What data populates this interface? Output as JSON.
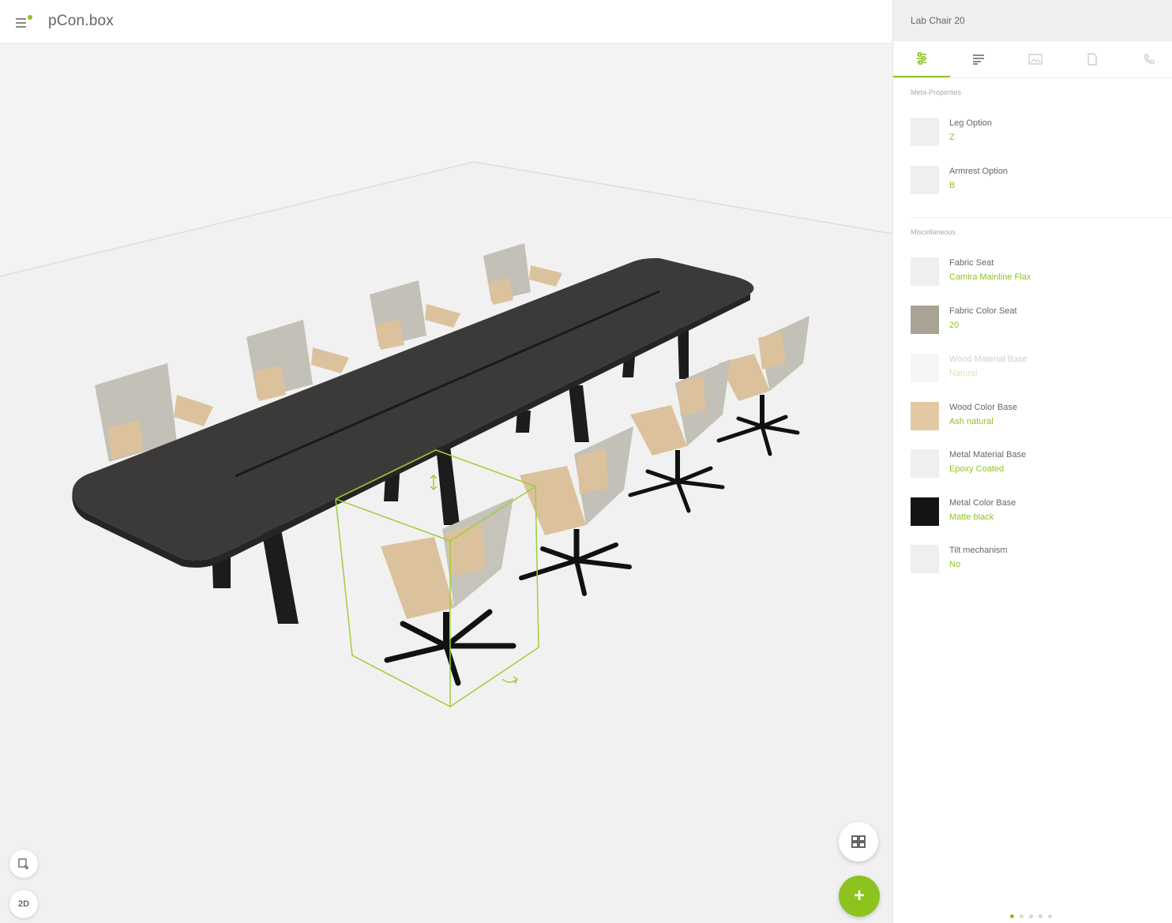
{
  "app": {
    "title": "pCon.box"
  },
  "viewport": {
    "buttons": {
      "add_label": "+",
      "mode_2d_label": "2D"
    },
    "accent_color": "#8dc31f"
  },
  "panel": {
    "title": "Lab Chair 20",
    "tabs": [
      {
        "icon": "configurator-icon",
        "active": true
      },
      {
        "icon": "article-list-icon",
        "active": false
      },
      {
        "icon": "image-icon",
        "active": false
      },
      {
        "icon": "document-icon",
        "active": false
      },
      {
        "icon": "phone-icon",
        "active": false
      }
    ],
    "meta_section": {
      "label": "Meta-Properties",
      "items": [
        {
          "name": "Leg Option",
          "value": "Z"
        },
        {
          "name": "Armrest Option",
          "value": "B"
        }
      ]
    },
    "misc_section": {
      "label": "Miscellaneous",
      "items": [
        {
          "name": "Fabric Seat",
          "value": "Camira Mainline Flax",
          "swatch": "#eeeeee"
        },
        {
          "name": "Fabric Color Seat",
          "value": "20",
          "swatch": "#a8a394"
        },
        {
          "name": "Wood Material Base",
          "value": "Natural",
          "swatch": "#f6f6f6",
          "disabled": true
        },
        {
          "name": "Wood Color Base",
          "value": "Ash natural",
          "swatch": "#e3c9a3"
        },
        {
          "name": "Metal Material Base",
          "value": "Epoxy Coated",
          "swatch": "#eeeeee"
        },
        {
          "name": "Metal Color Base",
          "value": "Matte black",
          "swatch": "#141414"
        },
        {
          "name": "Tilt mechanism",
          "value": "No",
          "swatch": "#eeeeee"
        }
      ]
    },
    "pagination": {
      "count": 5,
      "active": 1
    }
  }
}
